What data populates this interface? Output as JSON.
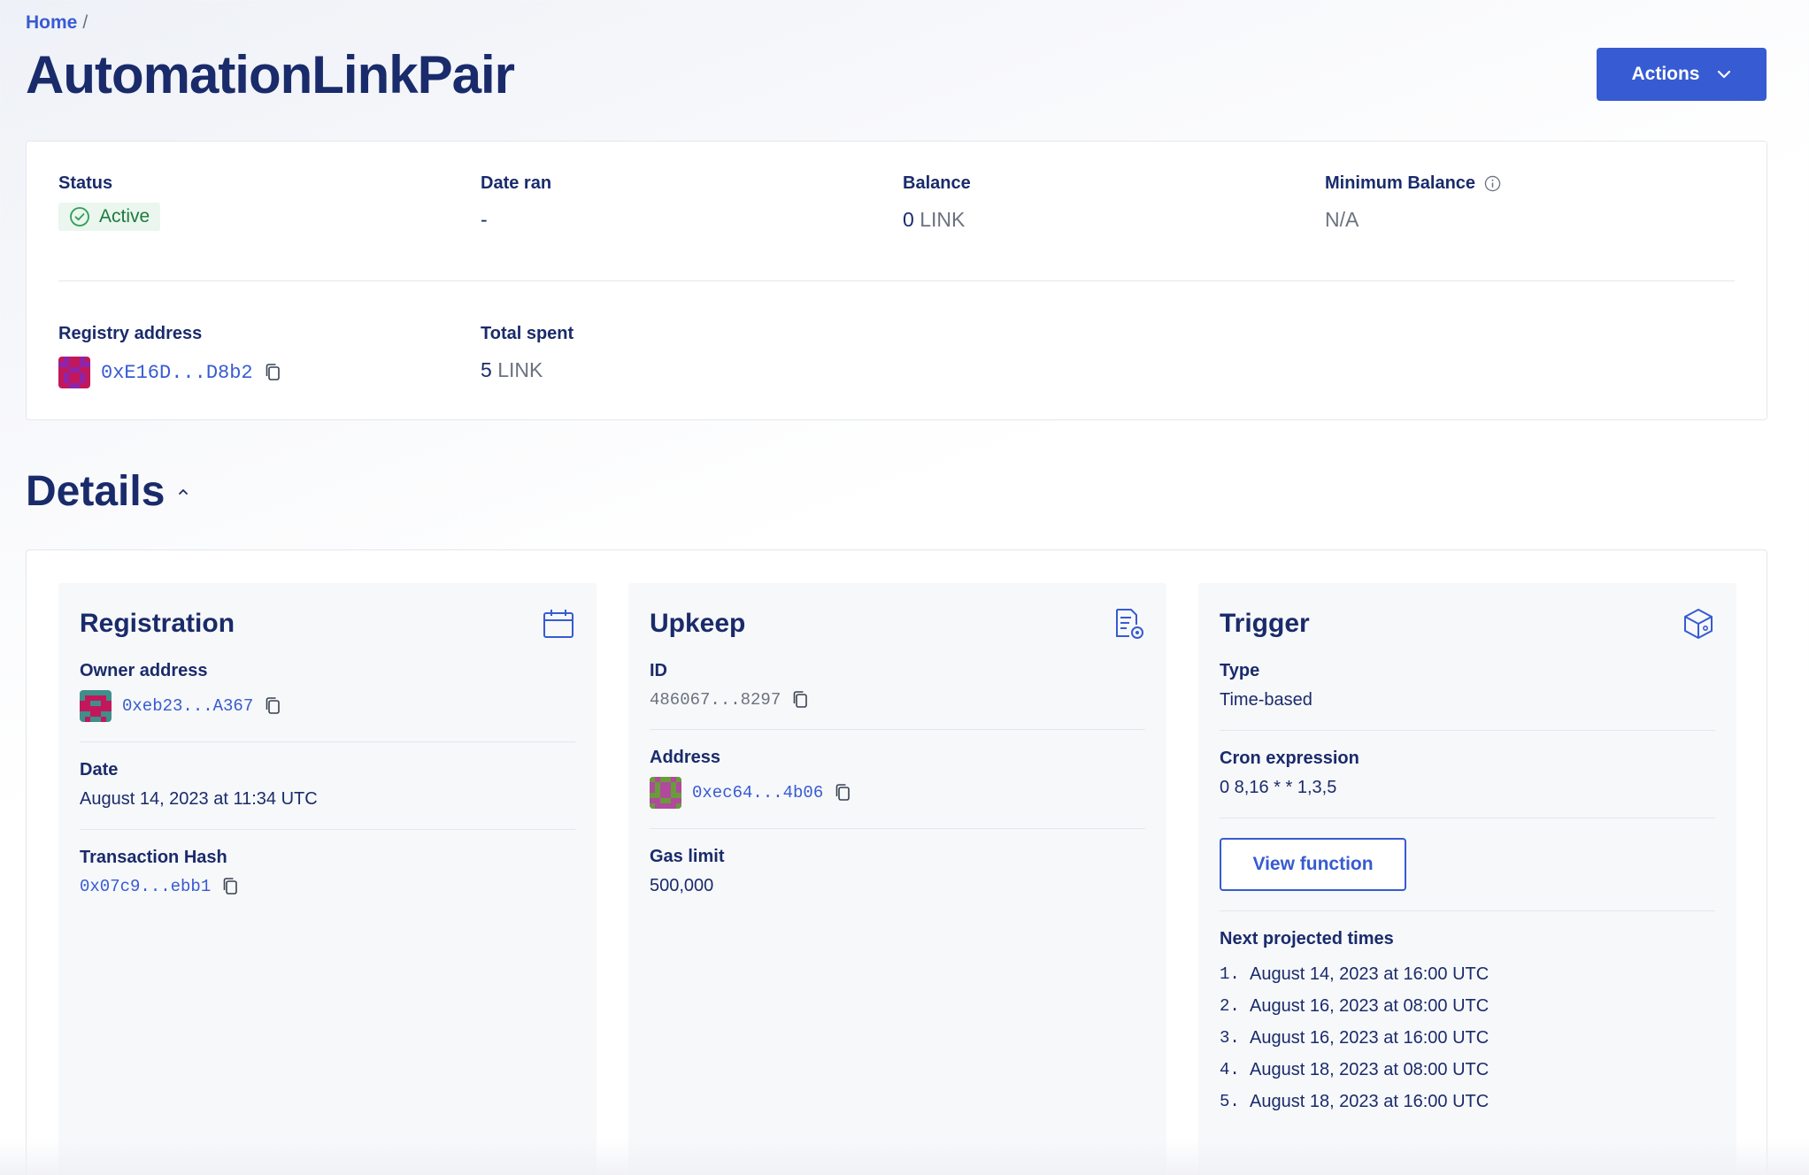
{
  "breadcrumb": {
    "home": "Home",
    "separator": "/"
  },
  "header": {
    "title": "AutomationLinkPair",
    "actions_label": "Actions"
  },
  "summary": {
    "status": {
      "label": "Status",
      "value": "Active"
    },
    "date_ran": {
      "label": "Date ran",
      "value": "-"
    },
    "balance": {
      "label": "Balance",
      "amount": "0",
      "unit": "LINK"
    },
    "min_balance": {
      "label": "Minimum Balance",
      "value": "N/A"
    },
    "registry": {
      "label": "Registry address",
      "value": "0xE16D...D8b2"
    },
    "total_spent": {
      "label": "Total spent",
      "amount": "5",
      "unit": "LINK"
    }
  },
  "details": {
    "title": "Details",
    "registration": {
      "title": "Registration",
      "owner_label": "Owner address",
      "owner_value": "0xeb23...A367",
      "date_label": "Date",
      "date_value": "August 14, 2023 at 11:34 UTC",
      "tx_label": "Transaction Hash",
      "tx_value": "0x07c9...ebb1"
    },
    "upkeep": {
      "title": "Upkeep",
      "id_label": "ID",
      "id_value": "486067...8297",
      "address_label": "Address",
      "address_value": "0xec64...4b06",
      "gas_label": "Gas limit",
      "gas_value": "500,000"
    },
    "trigger": {
      "title": "Trigger",
      "type_label": "Type",
      "type_value": "Time-based",
      "cron_label": "Cron expression",
      "cron_value": "0 8,16 * * 1,3,5",
      "view_fn_label": "View function",
      "next_label": "Next projected times",
      "times": [
        {
          "n": "1.",
          "t": "August 14, 2023 at 16:00 UTC"
        },
        {
          "n": "2.",
          "t": "August 16, 2023 at 08:00 UTC"
        },
        {
          "n": "3.",
          "t": "August 16, 2023 at 16:00 UTC"
        },
        {
          "n": "4.",
          "t": "August 18, 2023 at 08:00 UTC"
        },
        {
          "n": "5.",
          "t": "August 18, 2023 at 16:00 UTC"
        }
      ]
    }
  },
  "colors": {
    "accent": "#375bd2",
    "navy": "#1a2b6b",
    "success": "#1f7a3d",
    "muted": "#6b7280"
  },
  "icons": [
    "check-circle-icon",
    "info-icon",
    "copy-icon",
    "calendar-icon",
    "document-gear-icon",
    "cube-icon",
    "chevron-down-icon",
    "caret-up-icon"
  ]
}
